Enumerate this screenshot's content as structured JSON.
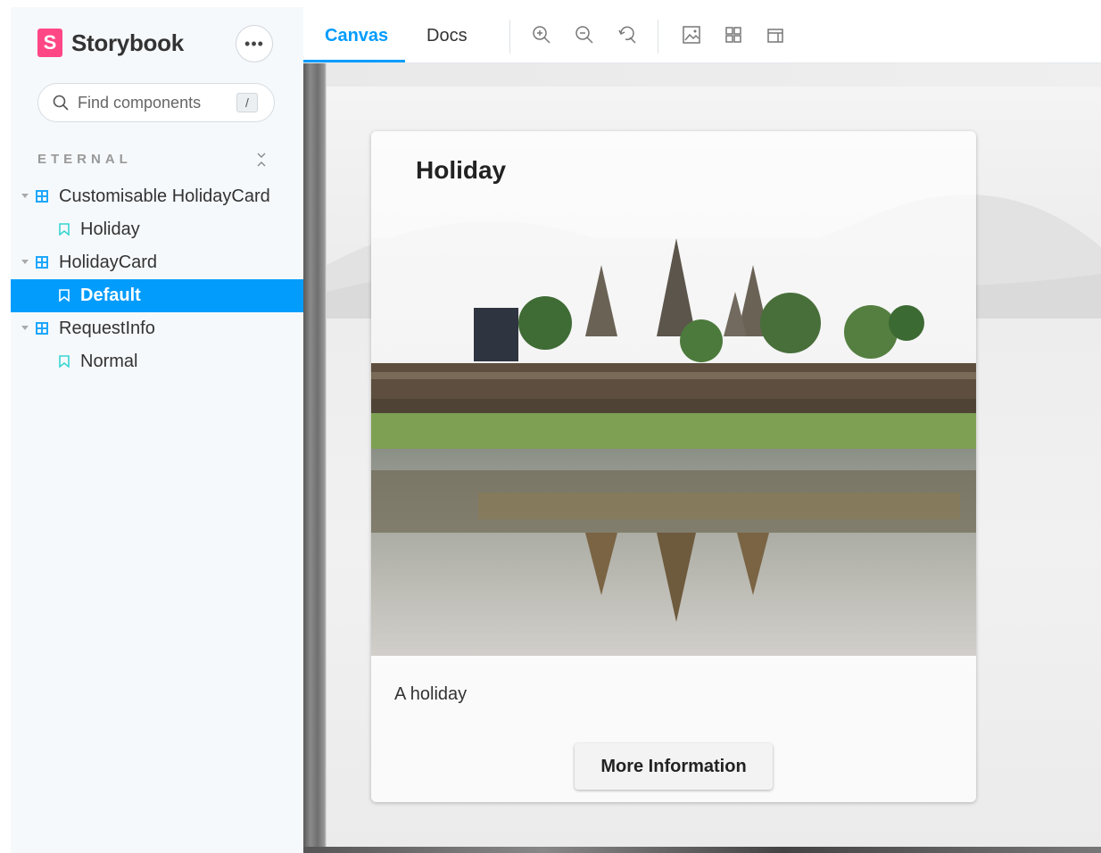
{
  "app": {
    "brand_logo": "S",
    "brand_name": "Storybook",
    "more_menu_label": "•••"
  },
  "sidebar": {
    "search_placeholder": "Find components",
    "search_shortcut": "/",
    "section_title": "ETERNAL",
    "tree": [
      {
        "type": "component",
        "label": "Customisable HolidayCard"
      },
      {
        "type": "story",
        "label": "Holiday"
      },
      {
        "type": "component",
        "label": "HolidayCard"
      },
      {
        "type": "story",
        "label": "Default",
        "selected": true
      },
      {
        "type": "component",
        "label": "RequestInfo"
      },
      {
        "type": "story",
        "label": "Normal"
      }
    ]
  },
  "toolbar": {
    "tabs": [
      "Canvas",
      "Docs"
    ],
    "active_tab": "Canvas",
    "tools": [
      "zoom-in-icon",
      "zoom-out-icon",
      "zoom-reset-icon",
      "background-icon",
      "grid-icon",
      "measure-icon"
    ]
  },
  "card": {
    "title": "Holiday",
    "image_subject": "temple-reflection-photo",
    "description": "A holiday",
    "button_label": "More Information"
  },
  "colors": {
    "accent": "#029cfd",
    "brand": "#ff4785"
  }
}
